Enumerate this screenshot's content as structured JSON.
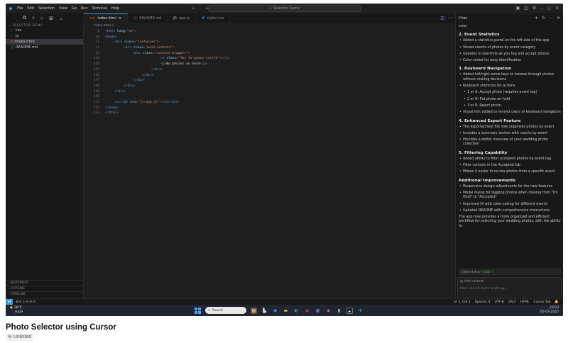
{
  "titlebar": {
    "menu": [
      "File",
      "Edit",
      "Selection",
      "View",
      "Go",
      "Run",
      "Terminal",
      "Help"
    ],
    "search": "Selector Demo",
    "nav_arrows": "← →"
  },
  "sidebar": {
    "section": "SELECTOR DEMO",
    "items": [
      {
        "label": "css",
        "icon": "chevron-right-icon"
      },
      {
        "label": "js",
        "icon": "chevron-right-icon"
      },
      {
        "label": "index.html",
        "icon": "html-file-icon"
      },
      {
        "label": "README.md",
        "icon": "info-icon"
      }
    ],
    "bottom": [
      "NOTEPADS",
      "OUTLINE",
      "TIMELINE"
    ]
  },
  "tabs": [
    {
      "label": "index.html",
      "active": true,
      "close": "✕"
    },
    {
      "label": "README.md",
      "active": false
    },
    {
      "label": "app.js",
      "active": false
    },
    {
      "label": "styles.css",
      "active": false
    }
  ],
  "breadcrumb": "index.html > ...",
  "editor": {
    "lines": [
      {
        "n": "2",
        "indent": 0,
        "html": "<span class=\"pun\">&lt;</span><span class=\"tag\">html</span> <span class=\"attr\">lang</span><span class=\"pun\">=</span><span class=\"str\">\"en\"</span><span class=\"pun\">&gt;</span>"
      },
      {
        "n": "10",
        "indent": 0,
        "html": "<span class=\"pun\">&lt;</span><span class=\"tag\">body</span><span class=\"pun\">&gt;</span>"
      },
      {
        "n": "11",
        "indent": 1,
        "html": "<span class=\"pun\">&lt;</span><span class=\"tag\">div</span> <span class=\"attr\">class</span><span class=\"pun\">=</span><span class=\"str\">\"container\"</span><span class=\"pun\">&gt;</span>"
      },
      {
        "n": "12",
        "indent": 2,
        "html": "<span class=\"pun\">&lt;</span><span class=\"tag\">div</span> <span class=\"attr\">class</span><span class=\"pun\">=</span><span class=\"str\">\"main-content\"</span><span class=\"pun\">&gt;</span>"
      },
      {
        "n": "13",
        "indent": 3,
        "html": "<span class=\"pun\">&lt;</span><span class=\"tag\">div</span> <span class=\"attr\">class</span><span class=\"pun\">=</span><span class=\"str\">\"content-wrapper\"</span><span class=\"pun\">&gt;</span>"
      },
      {
        "n": "143",
        "indent": 6,
        "html": "<span class=\"pun\">&lt;</span><span class=\"tag\">i</span> <span class=\"attr\">class</span><span class=\"pun\">=</span><span class=\"str\">\"fas fa-pause-circle\"</span><span class=\"pun\">&gt;&lt;/</span><span class=\"tag\">i</span><span class=\"pun\">&gt;</span>"
      },
      {
        "n": "144",
        "indent": 6,
        "html": "<span class=\"pun\">&lt;</span><span class=\"tag\">p</span><span class=\"pun\">&gt;</span><span class=\"txt\">No photos on hold</span><span class=\"pun\">&lt;/</span><span class=\"tag\">p</span><span class=\"pun\">&gt;</span>"
      },
      {
        "n": "145",
        "indent": 5,
        "html": "<span class=\"pun\">&lt;/</span><span class=\"tag\">div</span><span class=\"pun\">&gt;</span>"
      },
      {
        "n": "146",
        "indent": 4,
        "html": "<span class=\"pun\">&lt;/</span><span class=\"tag\">div</span><span class=\"pun\">&gt;</span>"
      },
      {
        "n": "147",
        "indent": 3,
        "html": "<span class=\"pun\">&lt;/</span><span class=\"tag\">div</span><span class=\"pun\">&gt;</span>"
      },
      {
        "n": "148",
        "indent": 2,
        "html": "<span class=\"pun\">&lt;/</span><span class=\"tag\">div</span><span class=\"pun\">&gt;</span>"
      },
      {
        "n": "149",
        "indent": 1,
        "html": "<span class=\"pun\">&lt;/</span><span class=\"tag\">div</span><span class=\"pun\">&gt;</span>"
      },
      {
        "n": "150",
        "indent": 0,
        "html": ""
      },
      {
        "n": "151",
        "indent": 1,
        "html": "<span class=\"pun\">&lt;</span><span class=\"tag\">script</span> <span class=\"attr\">src</span><span class=\"pun\">=</span><span class=\"str\">\"js/app.js\"</span><span class=\"pun\">&gt;&lt;/</span><span class=\"tag\">script</span><span class=\"pun\">&gt;</span>"
      },
      {
        "n": "152",
        "indent": 0,
        "html": "<span class=\"pun\">&lt;/</span><span class=\"tag\">body</span><span class=\"pun\">&gt;</span>"
      },
      {
        "n": "153",
        "indent": 0,
        "html": "<span class=\"pun\">&lt;/</span><span class=\"tag\">html</span><span class=\"pun\">&gt;</span>"
      }
    ]
  },
  "chat": {
    "title": "Chat",
    "intro": "view",
    "sections": [
      {
        "heading": "2. Event Statistics",
        "items": [
          "Added a statistics panel on the left side of the app",
          "Shows counts of photos by event category",
          "Updates in real-time as you tag and accept photos",
          "Color-coded for easy identification"
        ]
      },
      {
        "heading": "3. Keyboard Navigation",
        "items": [
          "Added left/right arrow keys to browse through photos without making decisions",
          "Keyboard shortcuts for actions:",
          {
            "sub": "1 or A: Accept photo (requires event tag)"
          },
          {
            "sub": "2 or H: Put photo on hold"
          },
          {
            "sub": "3 or R: Reject photo"
          },
          "Visual hint added to remind users of keyboard navigation"
        ]
      },
      {
        "heading": "4. Enhanced Export Feature",
        "items": [
          "The exported text file now organizes photos by event",
          "Includes a summary section with counts by event",
          "Provides a better overview of your wedding photo collection"
        ]
      },
      {
        "heading": "5. Filtering Capability",
        "items": [
          "Added ability to filter accepted photos by event tag",
          "Filter controls in the Accepted tab",
          "Makes it easier to review photos from a specific event"
        ]
      },
      {
        "heading": "Additional Improvements",
        "items": [
          "Responsive design adjustments for the new features",
          "Modal dialog for tagging photos when moving from \"On Hold\" to \"Accepted\"",
          "Improved UI with color-coding for different events",
          "Updated README with comprehensive instructions"
        ]
      }
    ],
    "outro": "The app now provides a more organized and efficient workflow for selecting your wedding photos, with the ability to",
    "edited": {
      "label": "Edited 4 files",
      "added": "+1416",
      "removed": "-1"
    },
    "input": {
      "context": "@ Add context",
      "placeholder": "Plan, search, build anything...",
      "agent": "∞ Agent  Ctrl+I",
      "model": "claude-3.7-sonnet ⌄",
      "send": "Send ⏎"
    }
  },
  "statusbar": {
    "left": "⊗ 0 ⚠ 0    ⓦ 0",
    "right": [
      "Ln 1, Col 1",
      "Spaces: 4",
      "UTF-8",
      "CRLF",
      "HTML",
      "Cursor Tab",
      "🔔"
    ]
  },
  "taskbar": {
    "temp": "28°C",
    "weather": "Haze",
    "search": "Search",
    "time": "23:03",
    "date": "05-03-2025"
  },
  "caption": {
    "title": "Photo Selector using Cursor",
    "badge": "Unlisted"
  }
}
